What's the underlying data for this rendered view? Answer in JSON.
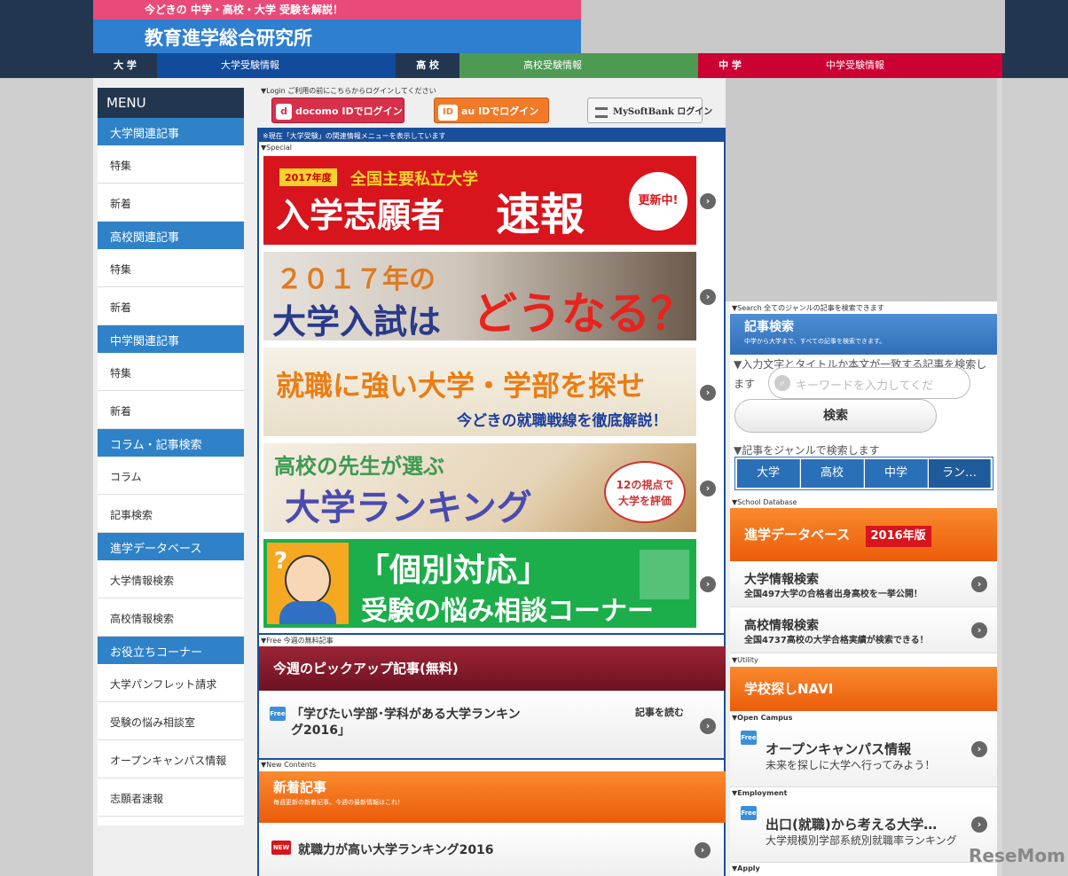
{
  "header": {
    "tagline": "今どきの 中学・高校・大学 受験を解説！",
    "site_title": "教育進学総合研究所",
    "nav": [
      {
        "label": "大 学",
        "link": "大学受験情報",
        "color": "#114b9c"
      },
      {
        "label": "高 校",
        "link": "高校受験情報",
        "color": "#4e9a53"
      },
      {
        "label": "中 学",
        "link": "中学受験情報",
        "color": "#cc0033"
      }
    ]
  },
  "sidebar": {
    "title": "MENU",
    "sections": [
      {
        "heading": "大学関連記事",
        "items": [
          "特集",
          "新着"
        ]
      },
      {
        "heading": "高校関連記事",
        "items": [
          "特集",
          "新着"
        ]
      },
      {
        "heading": "中学関連記事",
        "items": [
          "特集",
          "新着"
        ]
      },
      {
        "heading": "コラム・記事検索",
        "items": [
          "コラム",
          "記事検索"
        ]
      },
      {
        "heading": "進学データベース",
        "items": [
          "大学情報検索",
          "高校情報検索"
        ]
      },
      {
        "heading": "お役立ちコーナー",
        "items": [
          "大学パンフレット請求",
          "受験の悩み相談室",
          "オープンキャンパス情報",
          "志願者速報"
        ]
      }
    ]
  },
  "login": {
    "label": "▼Login ご利用の前にこちらからログインしてください",
    "docomo": "docomo IDでログイン",
    "au": "au IDでログイン",
    "softbank": "MySoftBank ログイン",
    "docomo_mark": "d",
    "au_mark": "ID"
  },
  "main": {
    "notice": "※現在「大学受験」の関連情報メニューを表示しています",
    "special_label": "▼Special",
    "banners": {
      "b1_year": "2017年度",
      "b1_sub": "全国主要私立大学",
      "b1_title": "入学志願者",
      "b1_title2": "速報",
      "b1_badge": "更新中!",
      "b2_line1": "２０１７年の",
      "b2_line2": "大学入試は",
      "b2_line3": "どうなる？",
      "b3_line1": "就職に強い大学・学部を探せ",
      "b3_line2": "今どきの就職戦線を徹底解説！",
      "b4_line1": "高校の先生が選ぶ",
      "b4_line2": "大学ランキング",
      "b4_badge": "12の視点で大学を評価",
      "b5_line1": "「個別対応」",
      "b5_line2": "受験の悩み相談コーナー"
    },
    "free_label": "▼Free 今週の無料記事",
    "pickup_title": "今週のピックアップ記事(無料)",
    "pickup_read": "記事を読む",
    "pickup_article": "「学びたい学部･学科がある大学ランキング2016」",
    "pickup_badge": "Free",
    "new_label": "▼New Contents",
    "new_title": "新着記事",
    "new_sub": "毎週更新の新着記事。今週の最新情報はこれ！",
    "new_article": "就職力が高い大学ランキング2016",
    "new_badge": "NEW"
  },
  "right": {
    "search_label": "▼Search 全てのジャンルの記事を検索できます",
    "search_title": "記事検索",
    "search_sub": "中学から大学まで、すべての記事を検索できます。",
    "search_desc": "▼入力文字とタイトルか本文が一致する記事を検索します",
    "search_placeholder": "キーワードを入力してくだ",
    "search_button": "検索",
    "genre_desc": "▼記事をジャンルで検索します",
    "genres": [
      "大学",
      "高校",
      "中学",
      "ラン…"
    ],
    "db_label": "▼School Database",
    "db_title": "進学データベース",
    "db_year": "2016年版",
    "db_items": [
      {
        "title": "大学情報検索",
        "desc": "全国497大学の合格者出身高校を一挙公開！"
      },
      {
        "title": "高校情報検索",
        "desc": "全国4737高校の大学合格実績が検索できる！"
      }
    ],
    "utility_label": "▼Utility",
    "utility_title": "学校探しNAVI",
    "oc_label": "▼Open Campus",
    "oc_title": "オープンキャンパス情報",
    "oc_desc": "未来を探しに大学へ行ってみよう！",
    "emp_label": "▼Employment",
    "emp_title": "出口(就職)から考える大学…",
    "emp_desc": "大学規模別学部系統別就職率ランキング",
    "apply_label": "▼Apply",
    "free_badge": "Free"
  },
  "watermark": "ReseMom"
}
